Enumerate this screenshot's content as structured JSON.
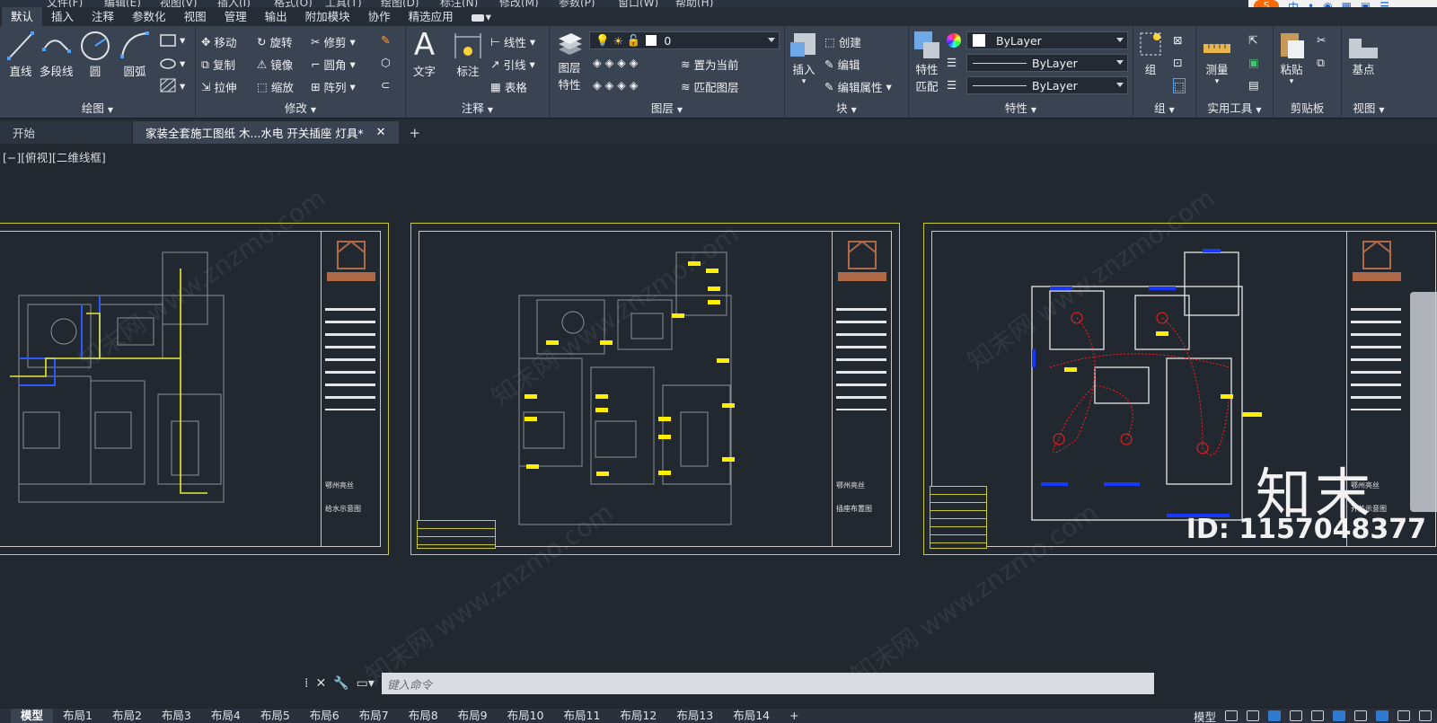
{
  "top_strip": {
    "items": [
      "文件(F)",
      "编辑(E)",
      "视图(V)",
      "插入(I)",
      "格式(O)",
      "工具(T)",
      "绘图(D)",
      "标注(N)",
      "修改(M)",
      "参数(P)",
      "窗口(W)",
      "帮助(H)"
    ]
  },
  "ribbon_tabs": [
    "默认",
    "插入",
    "注释",
    "参数化",
    "视图",
    "管理",
    "输出",
    "附加模块",
    "协作",
    "精选应用"
  ],
  "ribbon_tab_active": "默认",
  "panels": {
    "draw": {
      "title": "绘图",
      "line": "直线",
      "polyline": "多段线",
      "circle": "圆",
      "arc": "圆弧"
    },
    "modify": {
      "title": "修改",
      "move": "移动",
      "rotate": "旋转",
      "trim": "修剪",
      "copy": "复制",
      "mirror": "镜像",
      "fillet": "圆角",
      "stretch": "拉伸",
      "scale": "缩放",
      "array": "阵列"
    },
    "annotation": {
      "title": "注释",
      "text": "文字",
      "dimension": "标注",
      "linear": "线性",
      "leader": "引线",
      "table": "表格"
    },
    "layers": {
      "title": "图层",
      "layer_props": "图层\n特性",
      "layer_props_a": "图层",
      "layer_props_b": "特性",
      "current_layer": "0",
      "set_current": "置为当前",
      "match_layer": "匹配图层"
    },
    "block": {
      "title": "块",
      "insert": "插入",
      "create": "创建",
      "edit": "编辑",
      "edit_attr": "编辑属性"
    },
    "properties": {
      "title": "特性",
      "match_a": "特性",
      "match_b": "匹配",
      "color": "ByLayer",
      "linetype": "ByLayer",
      "lineweight": "ByLayer"
    },
    "groups": {
      "title": "组",
      "group": "组"
    },
    "utilities": {
      "title": "实用工具",
      "measure": "测量"
    },
    "clipboard": {
      "title": "剪贴板",
      "paste": "粘贴"
    },
    "view": {
      "title": "视图",
      "base": "基点"
    }
  },
  "doc_tabs": [
    {
      "label": "开始",
      "active": false
    },
    {
      "label": "家装全套施工图纸 木...水电 开关插座 灯具*",
      "active": true
    }
  ],
  "viewport_label": "[−][俯视][二维线框]",
  "sheets": [
    {
      "company": "鄂州亮丝",
      "title": "给水示意图"
    },
    {
      "company": "鄂州亮丝",
      "title": "插座布置图"
    },
    {
      "company": "鄂州亮丝",
      "title": "开关示意图"
    }
  ],
  "watermark": "知末网 www.znzmo.com",
  "brand": "知末",
  "id_text": "ID: 1157048377",
  "command_placeholder": "键入命令",
  "layout_tabs": [
    "模型",
    "布局1",
    "布局2",
    "布局3",
    "布局4",
    "布局5",
    "布局6",
    "布局7",
    "布局8",
    "布局9",
    "布局10",
    "布局11",
    "布局12",
    "布局13",
    "布局14"
  ],
  "layout_active": "模型",
  "status_model": "模型",
  "colors": {
    "accent": "#2f7bd1",
    "sheet_border": "#c8c83a",
    "canvas": "#212830",
    "ribbon": "#3a4352"
  }
}
